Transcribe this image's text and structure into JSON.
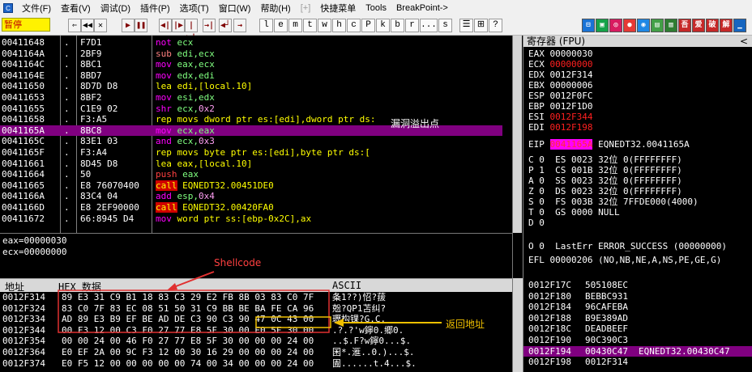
{
  "title_bar": {
    "app_icon": "C",
    "menus": [
      "文件(F)",
      "查看(V)",
      "调试(D)",
      "插件(P)",
      "选项(T)",
      "窗口(W)",
      "帮助(H)",
      "[+]",
      "快捷菜单",
      "Tools",
      "BreakPoint->"
    ]
  },
  "toolbar": {
    "status": "暂停",
    "buttons": [
      "⇐",
      "◀◀",
      "✕",
      "▶",
      "❚❚",
      "◀|",
      "|▶",
      "|▶|",
      "→|",
      "◀┘",
      "→"
    ],
    "letters": [
      "l",
      "e",
      "m",
      "t",
      "w",
      "h",
      "c",
      "P",
      "k",
      "b",
      "r",
      "...",
      "s"
    ],
    "extra": [
      "☰",
      "⊞",
      "?"
    ],
    "color_buttons": [
      {
        "label": "⊟",
        "color": "#1a73d6"
      },
      {
        "label": "▣",
        "color": "#16a34a"
      },
      {
        "label": "◎",
        "color": "#d81b60"
      },
      {
        "label": "●",
        "color": "#e53935"
      },
      {
        "label": "◉",
        "color": "#1e88e5"
      },
      {
        "label": "▤",
        "color": "#43a047"
      },
      {
        "label": "▥",
        "color": "#2e7d32"
      },
      {
        "label": "吾",
        "color": "#c62828"
      },
      {
        "label": "爱",
        "color": "#c62828"
      },
      {
        "label": "破",
        "color": "#c62828"
      },
      {
        "label": "解",
        "color": "#c62828"
      },
      {
        "label": "▁",
        "color": "#1565c0"
      }
    ]
  },
  "disasm": [
    {
      "addr": "00411648",
      "mark": ".",
      "hex": "F7D1",
      "asm": [
        {
          "t": "not ",
          "c": "k-m"
        },
        {
          "t": "ecx",
          "c": "k-r"
        }
      ]
    },
    {
      "addr": "0041164A",
      "mark": ".",
      "hex": "2BF9",
      "asm": [
        {
          "t": "sub ",
          "c": "k-a"
        },
        {
          "t": "edi,ecx",
          "c": "k-r"
        }
      ]
    },
    {
      "addr": "0041164C",
      "mark": ".",
      "hex": "8BC1",
      "asm": [
        {
          "t": "mov ",
          "c": "k-m"
        },
        {
          "t": "eax,ecx",
          "c": "k-r"
        }
      ]
    },
    {
      "addr": "0041164E",
      "mark": ".",
      "hex": "8BD7",
      "asm": [
        {
          "t": "mov ",
          "c": "k-m"
        },
        {
          "t": "edx,edi",
          "c": "k-r"
        }
      ]
    },
    {
      "addr": "00411650",
      "mark": ".",
      "hex": "8D7D D8",
      "asm": [
        {
          "t": "lea ",
          "c": "k-c"
        },
        {
          "t": "edi,[local.10]",
          "c": "k-c"
        }
      ]
    },
    {
      "addr": "00411653",
      "mark": ".",
      "hex": "8BF2",
      "asm": [
        {
          "t": "mov ",
          "c": "k-m"
        },
        {
          "t": "esi,edx",
          "c": "k-r"
        }
      ]
    },
    {
      "addr": "00411655",
      "mark": ".",
      "hex": "C1E9 02",
      "asm": [
        {
          "t": "shr ",
          "c": "k-m"
        },
        {
          "t": "ecx,",
          "c": "k-r"
        },
        {
          "t": "0x2",
          "c": "k-i"
        }
      ]
    },
    {
      "addr": "00411658",
      "mark": ".",
      "hex": "F3:A5",
      "asm": [
        {
          "t": "rep movs dword ptr es:[edi],dword ptr ds:",
          "c": "k-c"
        }
      ]
    },
    {
      "addr": "0041165A",
      "mark": ".",
      "hex": "8BC8",
      "asm": [
        {
          "t": "mov ",
          "c": "k-m"
        },
        {
          "t": "ecx,eax",
          "c": "k-r"
        }
      ],
      "sel": true
    },
    {
      "addr": "0041165C",
      "mark": ".",
      "hex": "83E1 03",
      "asm": [
        {
          "t": "and ",
          "c": "k-m"
        },
        {
          "t": "ecx,",
          "c": "k-r"
        },
        {
          "t": "0x3",
          "c": "k-i"
        }
      ]
    },
    {
      "addr": "0041165F",
      "mark": ".",
      "hex": "F3:A4",
      "asm": [
        {
          "t": "rep movs byte ptr es:[edi],byte ptr ds:[",
          "c": "k-c"
        }
      ]
    },
    {
      "addr": "00411661",
      "mark": ".",
      "hex": "8D45 D8",
      "asm": [
        {
          "t": "lea ",
          "c": "k-c"
        },
        {
          "t": "eax,[local.10]",
          "c": "k-c"
        }
      ]
    },
    {
      "addr": "00411664",
      "mark": ".",
      "hex": "50",
      "asm": [
        {
          "t": "push ",
          "c": "k-push"
        },
        {
          "t": "eax",
          "c": "k-r"
        }
      ]
    },
    {
      "addr": "00411665",
      "mark": ".",
      "hex": "E8 76070400",
      "asm": [
        {
          "t": "call",
          "c": "k-call"
        },
        {
          "t": " EQNEDT32.00451DE0",
          "c": "k-c"
        }
      ]
    },
    {
      "addr": "0041166A",
      "mark": ".",
      "hex": "83C4 04",
      "asm": [
        {
          "t": "add ",
          "c": "k-m"
        },
        {
          "t": "esp,",
          "c": "k-r"
        },
        {
          "t": "0x4",
          "c": "k-i"
        }
      ]
    },
    {
      "addr": "0041166D",
      "mark": ".",
      "hex": "E8 2EF90000",
      "asm": [
        {
          "t": "call",
          "c": "k-call"
        },
        {
          "t": " EQNEDT32.00420FA0",
          "c": "k-c"
        }
      ]
    },
    {
      "addr": "00411672",
      "mark": ".",
      "hex": "66:8945 D4",
      "asm": [
        {
          "t": "mov ",
          "c": "k-m"
        },
        {
          "t": "word ptr ss:[ebp-0x2C],ax",
          "c": "k-c"
        }
      ]
    }
  ],
  "info": [
    "eax=00000030",
    "ecx=00000000"
  ],
  "registers": {
    "header": "寄存器 (FPU)",
    "gpr": [
      {
        "name": "EAX",
        "val": "00000030",
        "red": false
      },
      {
        "name": "ECX",
        "val": "00000000",
        "red": true
      },
      {
        "name": "EDX",
        "val": "0012F314",
        "red": false
      },
      {
        "name": "EBX",
        "val": "00000006",
        "red": false
      },
      {
        "name": "ESP",
        "val": "0012F0FC",
        "red": false
      },
      {
        "name": "EBP",
        "val": "0012F1D0",
        "red": false
      },
      {
        "name": "ESI",
        "val": "0012F344",
        "red": true
      },
      {
        "name": "EDI",
        "val": "0012F198",
        "red": true
      }
    ],
    "eip": {
      "name": "EIP",
      "val": "0041165A",
      "label": "EQNEDT32.0041165A"
    },
    "flags": [
      "C 0  ES 0023 32位 0(FFFFFFFF)",
      "P 1  CS 001B 32位 0(FFFFFFFF)",
      "A 0  SS 0023 32位 0(FFFFFFFF)",
      "Z 0  DS 0023 32位 0(FFFFFFFF)",
      "S 0  FS 003B 32位 7FFDE000(4000)",
      "T 0  GS 0000 NULL",
      "D 0",
      "O 0  LastErr ERROR_SUCCESS (00000000)"
    ],
    "efl": "EFL 00000206 (NO,NB,NE,A,NS,PE,GE,G)"
  },
  "dump": {
    "headers": {
      "address": "地址",
      "hex": "HEX 数据",
      "ascii": "ASCII"
    },
    "rows": [
      {
        "addr": "0012F314",
        "hex": "89 E3 31 C9 B1 18 83 C3 29 E2 FB 8B 03 83 C0 7F",
        "ascii": "夈1??)怊?菝"
      },
      {
        "addr": "0012F324",
        "hex": "83 C0 7F 83 EC 08 51 50 31 C9 BB BE BA FE CA 96",
        "ascii": "兝?QP1苫纠?"
      },
      {
        "addr": "0012F334",
        "hex": "AD 89 E3 B9 EF BE AD DE C3 90 C3 90 47 0C 43 00",
        "ascii": "瓑构锞?G.C."
      },
      {
        "addr": "0012F344",
        "hex": "00 F3 12 00 C3 F0 27 77 E8 5F 30 00 E0 5F 30 00",
        "ascii": ".?.?'w鑏0.郷0."
      },
      {
        "addr": "0012F354",
        "hex": "00 00 24 00 46 F0 27 77 E8 5F 30 00 00 00 24 00",
        "ascii": "..$.F?w鑏0...$."
      },
      {
        "addr": "0012F364",
        "hex": "E0 EF 2A 00 9C F3 12 00 30 16 29 00 00 00 24 00",
        "ascii": "囷*.滙..0.)...$."
      },
      {
        "addr": "0012F374",
        "hex": "E0 F5 12 00 00 00 00 00 74 00 34 00 00 00 24 00",
        "ascii": "圊......t.4...$."
      }
    ]
  },
  "stack": [
    {
      "addr": "0012F17C",
      "val": "505108EC",
      "note": ""
    },
    {
      "addr": "0012F180",
      "val": "BEBBC931",
      "note": ""
    },
    {
      "addr": "0012F184",
      "val": "96CAFEBA",
      "note": ""
    },
    {
      "addr": "0012F188",
      "val": "B9E389AD",
      "note": ""
    },
    {
      "addr": "0012F18C",
      "val": "DEADBEEF",
      "note": ""
    },
    {
      "addr": "0012F190",
      "val": "90C390C3",
      "note": ""
    },
    {
      "addr": "0012F194",
      "val": "00430C47",
      "note": "EQNEDT32.00430C47",
      "sel": true
    },
    {
      "addr": "0012F198",
      "val": "0012F314",
      "note": ""
    }
  ],
  "annotations": {
    "overflow": "漏洞溢出点",
    "shellcode": "Shellcode",
    "return_addr": "返回地址"
  }
}
